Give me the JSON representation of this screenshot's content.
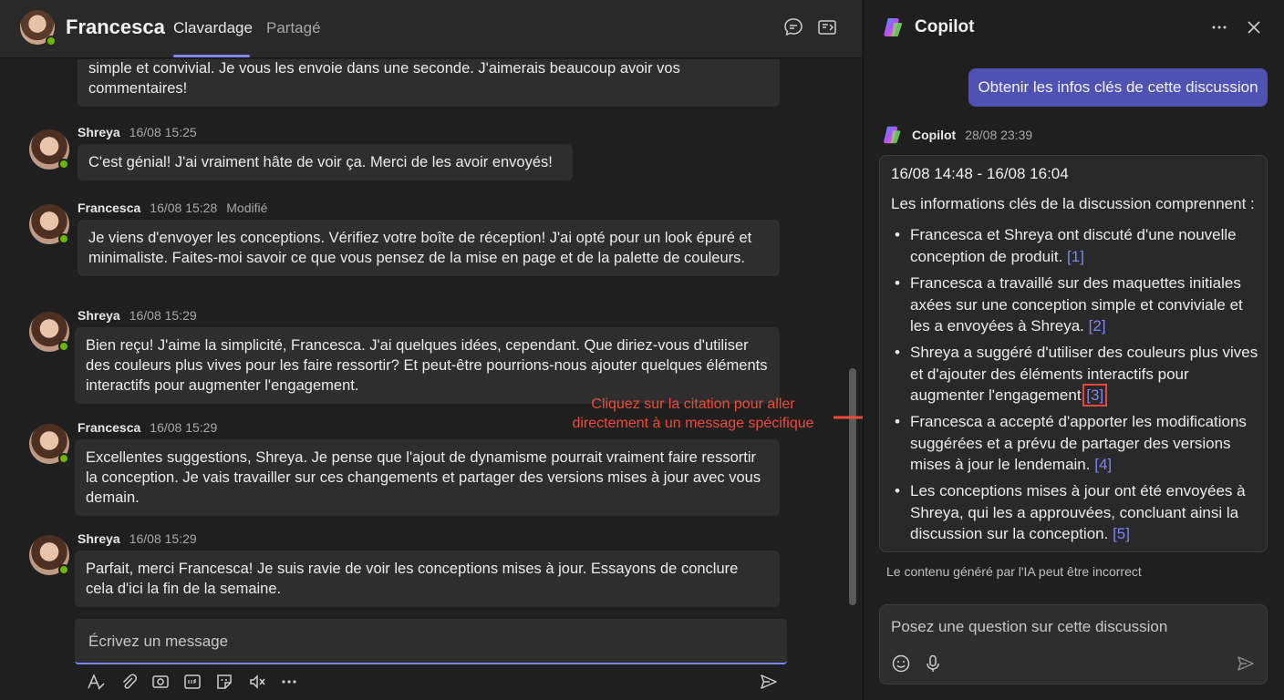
{
  "header": {
    "contact_name": "Francesca",
    "tabs": [
      "Clavardage",
      "Partagé"
    ],
    "active_tab": "Clavardage"
  },
  "messages": [
    {
      "text": "simple et convivial. Je vous les envoie dans une seconde. J'aimerais beaucoup avoir vos commentaires!"
    },
    {
      "sender": "Shreya",
      "time": "16/08 15:25",
      "text": "C'est génial! J'ai vraiment hâte de voir ça. Merci de les avoir envoyés!"
    },
    {
      "sender": "Francesca",
      "time": "16/08 15:28",
      "edited": "Modifié",
      "text": "Je viens d'envoyer les conceptions. Vérifiez votre boîte de réception! J'ai opté pour un look épuré et minimaliste. Faites-moi savoir ce que vous pensez de la mise en page et de la palette de couleurs."
    },
    {
      "sender": "Shreya",
      "time": "16/08 15:29",
      "text": "Bien reçu! J'aime la simplicité, Francesca. J'ai quelques idées, cependant. Que diriez-vous d'utiliser des couleurs plus vives pour les faire ressortir? Et peut-être pourrions-nous ajouter quelques éléments interactifs pour augmenter l'engagement."
    },
    {
      "sender": "Francesca",
      "time": "16/08 15:29",
      "text": "Excellentes suggestions, Shreya. Je pense que l'ajout de dynamisme pourrait vraiment faire ressortir la conception. Je vais travailler sur ces changements et partager des versions mises à jour avec vous demain."
    },
    {
      "sender": "Shreya",
      "time": "16/08 15:29",
      "text": "Parfait, merci Francesca! Je suis ravie de voir les conceptions mises à jour. Essayons de conclure cela d'ici la fin de la semaine."
    }
  ],
  "composer": {
    "placeholder": "Écrivez un message"
  },
  "annotation": {
    "text": "Cliquez sur la citation pour aller directement à un message spécifique"
  },
  "copilot": {
    "title": "Copilot",
    "prompt": "Obtenir les infos clés de cette discussion",
    "response_sender": "Copilot",
    "response_time": "28/08 23:39",
    "range": "16/08 14:48 - 16/08 16:04",
    "intro": "Les informations clés de la discussion comprennent :",
    "bullets": [
      {
        "text": "Francesca et Shreya ont discuté d'une nouvelle conception de produit.",
        "cite": "[1]"
      },
      {
        "text": "Francesca a travaillé sur des maquettes initiales axées sur une conception simple et conviviale et les a envoyées à Shreya.",
        "cite": "[2]"
      },
      {
        "text": "Shreya a suggéré d'utiliser des couleurs plus vives et d'ajouter des éléments interactifs pour augmenter l'engagement.",
        "cite": "[3]"
      },
      {
        "text": "Francesca a accepté d'apporter les modifications suggérées et a prévu de partager des versions mises à jour le lendemain.",
        "cite": "[4]"
      },
      {
        "text": "Les conceptions mises à jour ont été envoyées à Shreya, qui les a approuvées, concluant ainsi la discussion sur la conception.",
        "cite": "[5]"
      }
    ],
    "disclaimer": "Le contenu généré par l'IA peut être incorrect",
    "ask_placeholder": "Posez une question sur cette discussion"
  },
  "colors": {
    "accent": "#7f85f5",
    "prompt_bg": "#4f52b2",
    "annotation": "#ef4b3c",
    "presence": "#6bb700"
  }
}
